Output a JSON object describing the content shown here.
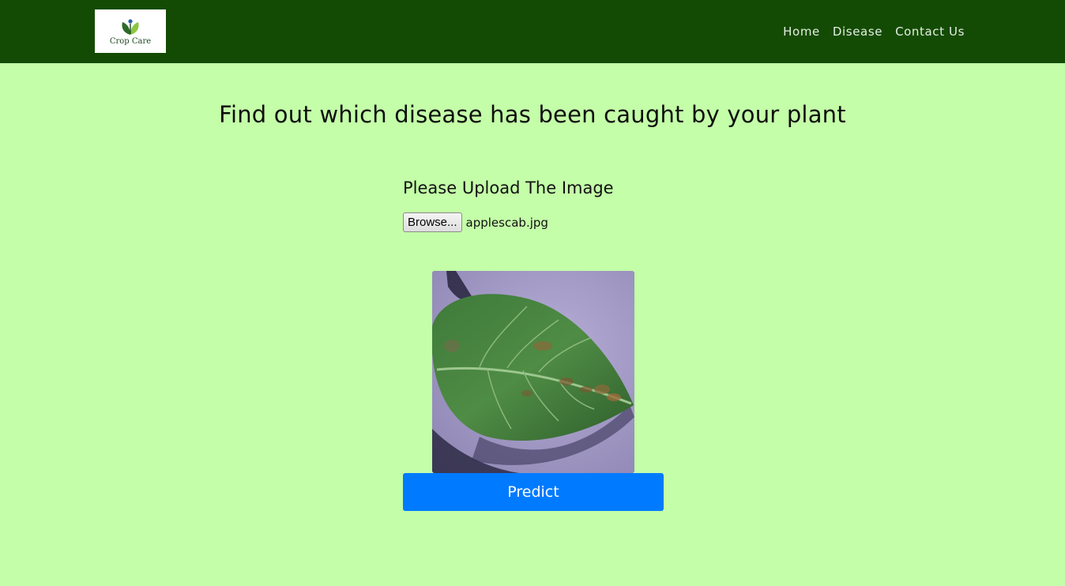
{
  "brand": {
    "logo_icon": "sprout-leaves-icon",
    "logo_text": "Crop Care"
  },
  "nav": {
    "items": [
      {
        "label": "Home"
      },
      {
        "label": "Disease"
      },
      {
        "label": "Contact Us"
      }
    ]
  },
  "main": {
    "heading": "Find out which disease has been caught by your plant",
    "upload_label": "Please Upload The Image",
    "browse_label": "Browse...",
    "file_name": "applescab.jpg",
    "preview_icon": "leaf-preview-image",
    "predict_label": "Predict"
  },
  "colors": {
    "navbar_bg": "#144b04",
    "page_bg": "#c4fea8",
    "predict_bg": "#007bff"
  }
}
